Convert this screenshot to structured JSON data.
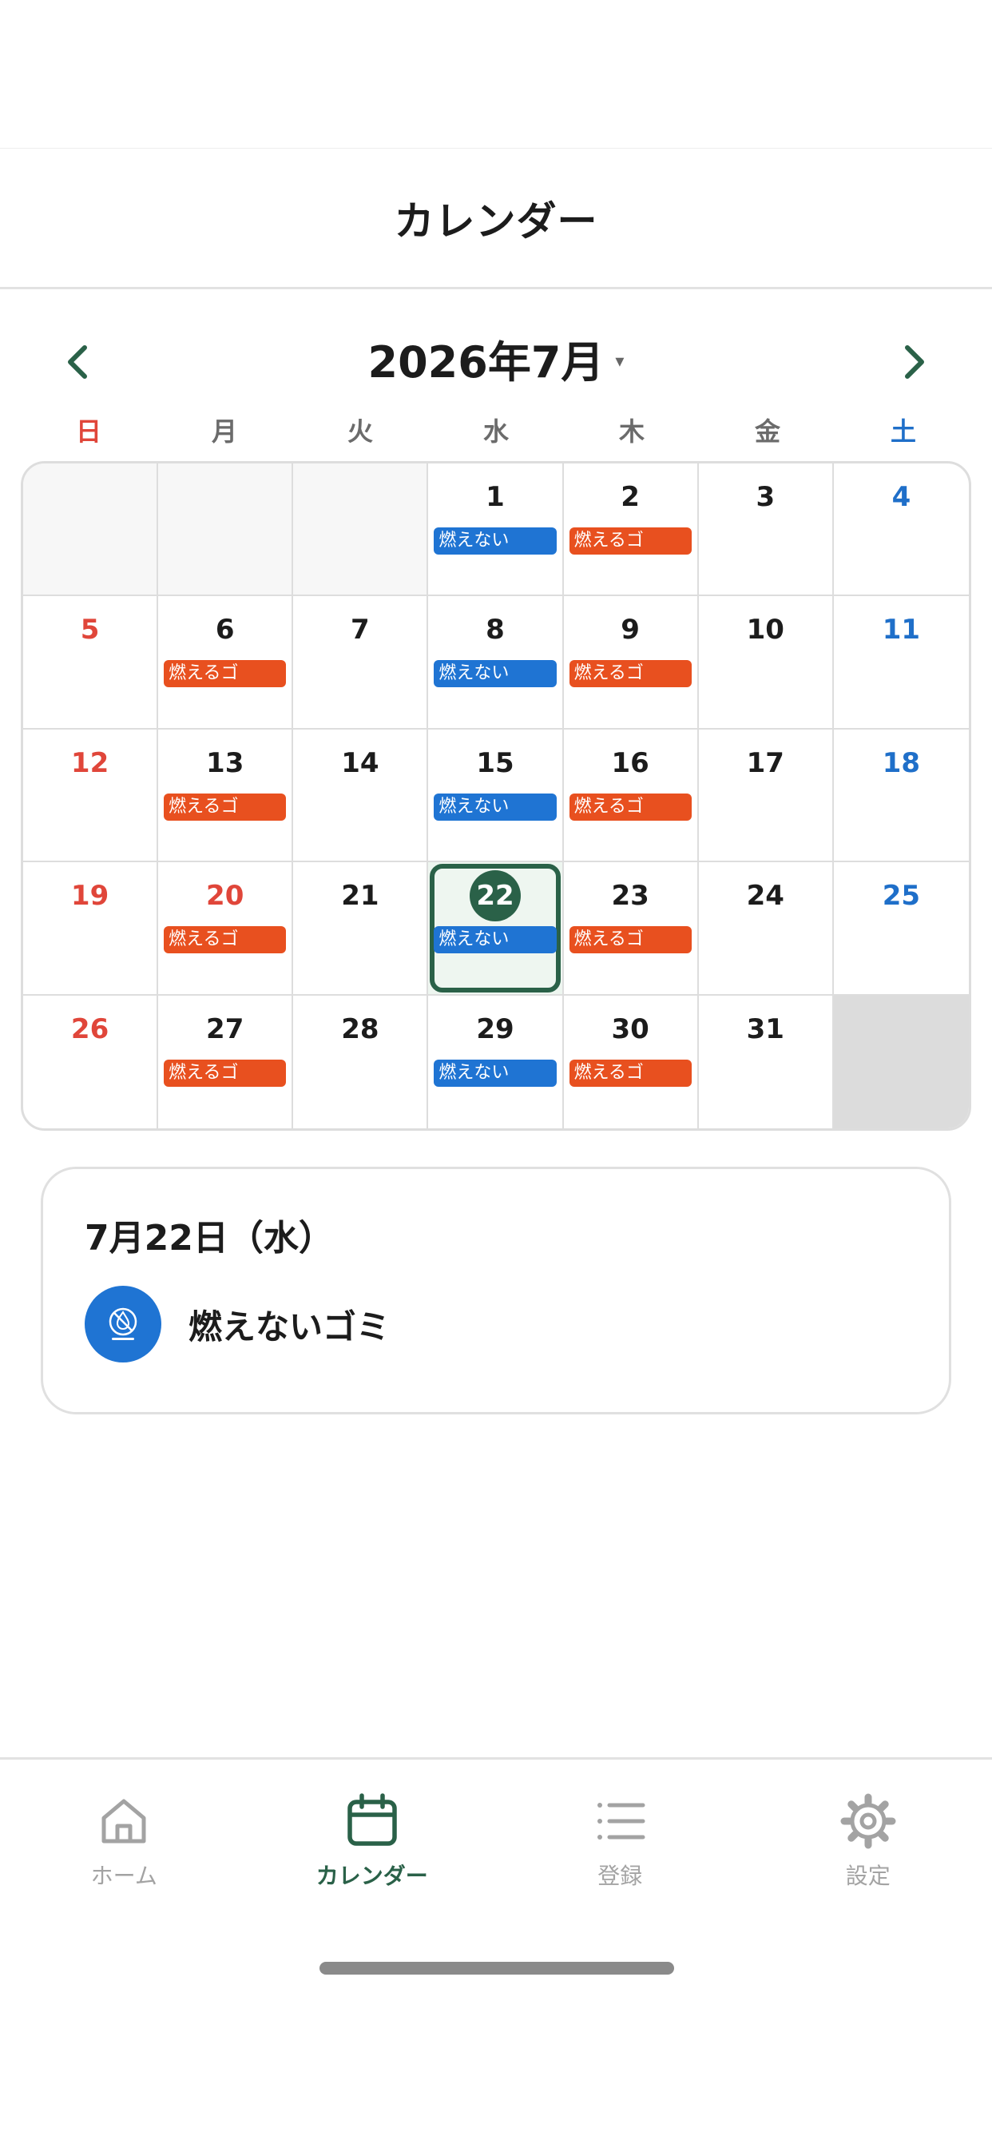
{
  "header": {
    "title": "カレンダー"
  },
  "calendar": {
    "month_title": "2026年7月",
    "caret": "▾",
    "weekdays": [
      "日",
      "月",
      "火",
      "水",
      "木",
      "金",
      "土"
    ],
    "tags": {
      "blue": "燃えない",
      "orange": "燃えるゴ"
    },
    "colors": {
      "accent": "#2a6148",
      "blue_tag": "#1f74d3",
      "orange_tag": "#e8501f",
      "sunday": "#e0463a",
      "saturday": "#1f6fc9"
    },
    "weeks": [
      [
        {
          "day": ""
        },
        {
          "day": ""
        },
        {
          "day": ""
        },
        {
          "day": "1",
          "tag": "blue"
        },
        {
          "day": "2",
          "tag": "orange"
        },
        {
          "day": "3"
        },
        {
          "day": "4"
        }
      ],
      [
        {
          "day": "5"
        },
        {
          "day": "6",
          "tag": "orange"
        },
        {
          "day": "7"
        },
        {
          "day": "8",
          "tag": "blue"
        },
        {
          "day": "9",
          "tag": "orange"
        },
        {
          "day": "10"
        },
        {
          "day": "11"
        }
      ],
      [
        {
          "day": "12"
        },
        {
          "day": "13",
          "tag": "orange"
        },
        {
          "day": "14"
        },
        {
          "day": "15",
          "tag": "blue"
        },
        {
          "day": "16",
          "tag": "orange"
        },
        {
          "day": "17"
        },
        {
          "day": "18"
        }
      ],
      [
        {
          "day": "19"
        },
        {
          "day": "20",
          "tag": "orange",
          "holiday": true
        },
        {
          "day": "21"
        },
        {
          "day": "22",
          "tag": "blue",
          "selected": true
        },
        {
          "day": "23",
          "tag": "orange"
        },
        {
          "day": "24"
        },
        {
          "day": "25"
        }
      ],
      [
        {
          "day": "26"
        },
        {
          "day": "27",
          "tag": "orange"
        },
        {
          "day": "28"
        },
        {
          "day": "29",
          "tag": "blue"
        },
        {
          "day": "30",
          "tag": "orange"
        },
        {
          "day": "31"
        },
        {
          "day": ""
        }
      ]
    ]
  },
  "detail": {
    "date": "7月22日（水）",
    "items": [
      {
        "label": "燃えないゴミ",
        "icon": "non-burnable-trash-icon"
      }
    ]
  },
  "tabbar": {
    "tabs": [
      {
        "label": "ホーム",
        "icon": "home-icon"
      },
      {
        "label": "カレンダー",
        "icon": "calendar-icon",
        "active": true
      },
      {
        "label": "登録",
        "icon": "list-icon"
      },
      {
        "label": "設定",
        "icon": "gear-icon"
      }
    ]
  }
}
